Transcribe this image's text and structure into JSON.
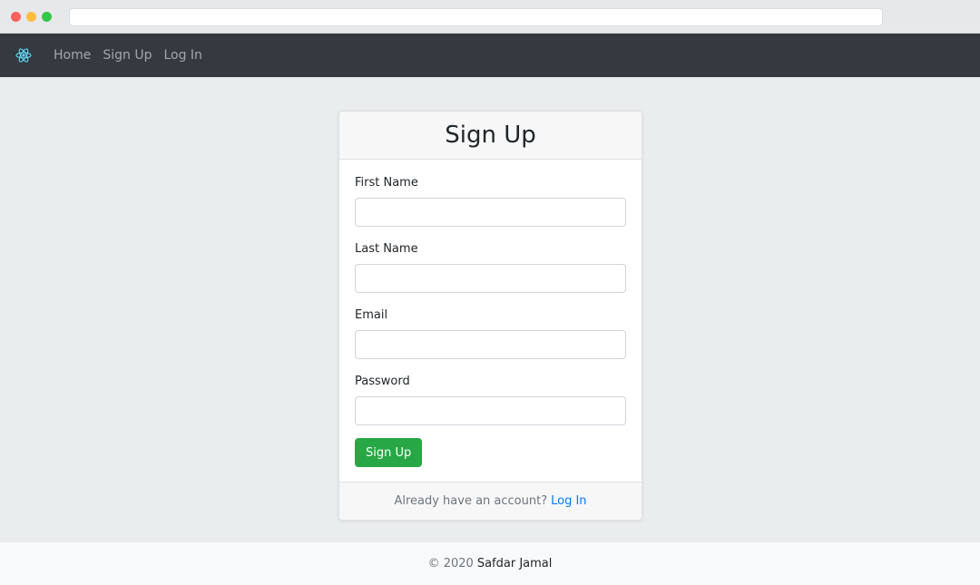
{
  "browser": {
    "controls": [
      "close",
      "minimize",
      "maximize"
    ]
  },
  "navbar": {
    "brand_icon": "react-atom-icon",
    "links": [
      {
        "label": "Home"
      },
      {
        "label": "Sign Up"
      },
      {
        "label": "Log In"
      }
    ]
  },
  "signup_card": {
    "title": "Sign Up",
    "fields": [
      {
        "label": "First Name",
        "value": "",
        "placeholder": ""
      },
      {
        "label": "Last Name",
        "value": "",
        "placeholder": ""
      },
      {
        "label": "Email",
        "value": "",
        "placeholder": ""
      },
      {
        "label": "Password",
        "value": "",
        "placeholder": ""
      }
    ],
    "submit_label": "Sign Up",
    "footer_prompt": "Already have an account?",
    "footer_link": "Log In"
  },
  "page_footer": {
    "copyright": "© 2020",
    "author": "Safdar Jamal"
  },
  "colors": {
    "navbar_bg": "#343a40",
    "submit_green": "#28a745",
    "link_blue": "#007bff",
    "brand_icon": "#61dafb"
  }
}
